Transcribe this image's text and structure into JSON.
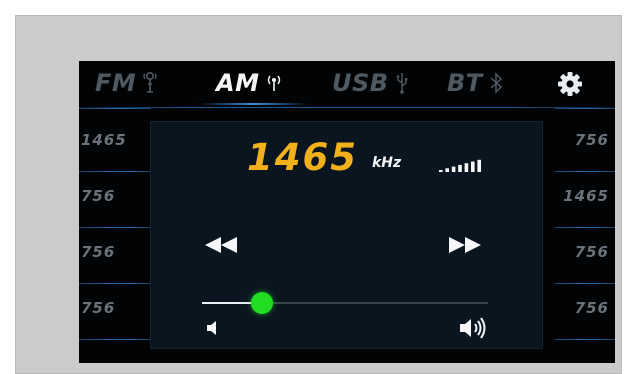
{
  "tabs": [
    {
      "id": "fm",
      "label": "FM",
      "icon": "antenna-icon",
      "active": false
    },
    {
      "id": "am",
      "label": "AM",
      "icon": "radio-signal-icon",
      "active": true
    },
    {
      "id": "usb",
      "label": "USB",
      "icon": "usb-icon",
      "active": false
    },
    {
      "id": "bt",
      "label": "BT",
      "icon": "bluetooth-icon",
      "active": false
    }
  ],
  "settings_icon": "gear-icon",
  "left_presets": [
    "1465",
    "756",
    "756",
    "756"
  ],
  "right_presets": [
    "756",
    "1465",
    "756",
    "756"
  ],
  "tuner": {
    "frequency": "1465",
    "unit": "kHz",
    "signal_strength_bars": 7
  },
  "volume": {
    "level": 0.21
  },
  "colors": {
    "accent": "#f2b11b",
    "slider_thumb": "#22dc22",
    "divider": "#1f5d93",
    "inactive_tab": "#4f5962"
  }
}
